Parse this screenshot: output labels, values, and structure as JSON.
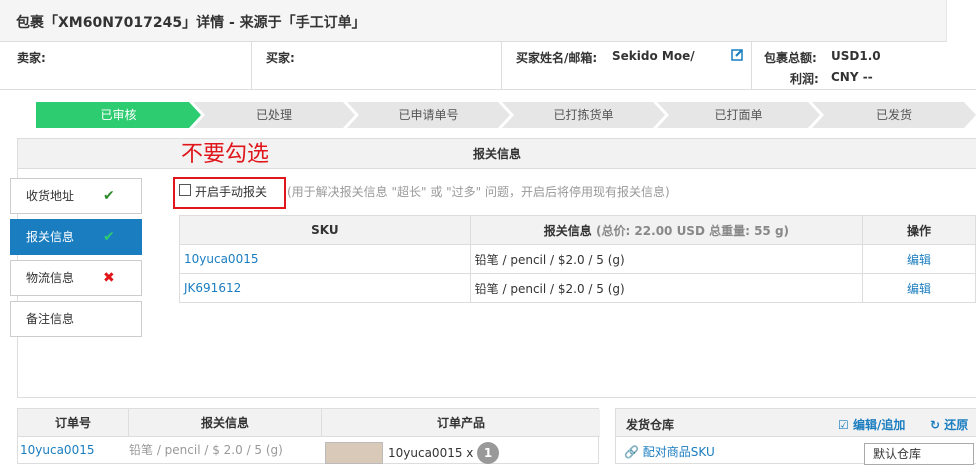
{
  "title": "包裹「XM60N7017245」详情 - 来源于「手工订单」",
  "info": {
    "seller_label": "卖家:",
    "buyer_label": "买家:",
    "buyer_name_label": "买家姓名/邮箱:",
    "buyer_name_value": "Sekido Moe/",
    "total_label": "包裹总额:",
    "total_value": "USD1.0",
    "profit_label": "利润:",
    "profit_value": "CNY --"
  },
  "steps": [
    "已审核",
    "已处理",
    "已申请单号",
    "已打拣货单",
    "已打面单",
    "已发货"
  ],
  "customs": {
    "header": "报关信息",
    "annotation": "不要勾选",
    "manual_label": "开启手动报关",
    "manual_hint": "(用于解决报关信息 \"超长\" 或 \"过多\" 问题，开启后将停用现有报关信息)",
    "col_sku": "SKU",
    "col_info": "报关信息",
    "col_info_total": "(总价: 22.00 USD 总重量: 55 g)",
    "col_ops": "操作",
    "rows": [
      {
        "sku": "10yuca0015",
        "info": "铅笔 / pencil / $2.0 / 5 (g)",
        "op": "编辑"
      },
      {
        "sku": "JK691612",
        "info": "铅笔 / pencil / $2.0 / 5 (g)",
        "op": "编辑"
      }
    ]
  },
  "side_tabs": [
    {
      "label": "收货地址",
      "status": "check"
    },
    {
      "label": "报关信息",
      "status": "check"
    },
    {
      "label": "物流信息",
      "status": "cross"
    },
    {
      "label": "备注信息",
      "status": ""
    }
  ],
  "colors": {
    "accent": "#1a7dc0",
    "success": "#2ecc71",
    "danger": "#e0161b"
  },
  "orders": {
    "col_order": "订单号",
    "col_info": "报关信息",
    "col_product": "订单产品",
    "row_order": "10yuca0015",
    "row_info": "铅笔 / pencil / $ 2.0 / 5 (g)",
    "row_product": "10yuca0015 x",
    "row_qty": "1"
  },
  "warehouse": {
    "title": "发货仓库",
    "edit": "编辑/追加",
    "restore": "还原",
    "match": "配对商品SKU",
    "select_value": "默认仓库"
  }
}
